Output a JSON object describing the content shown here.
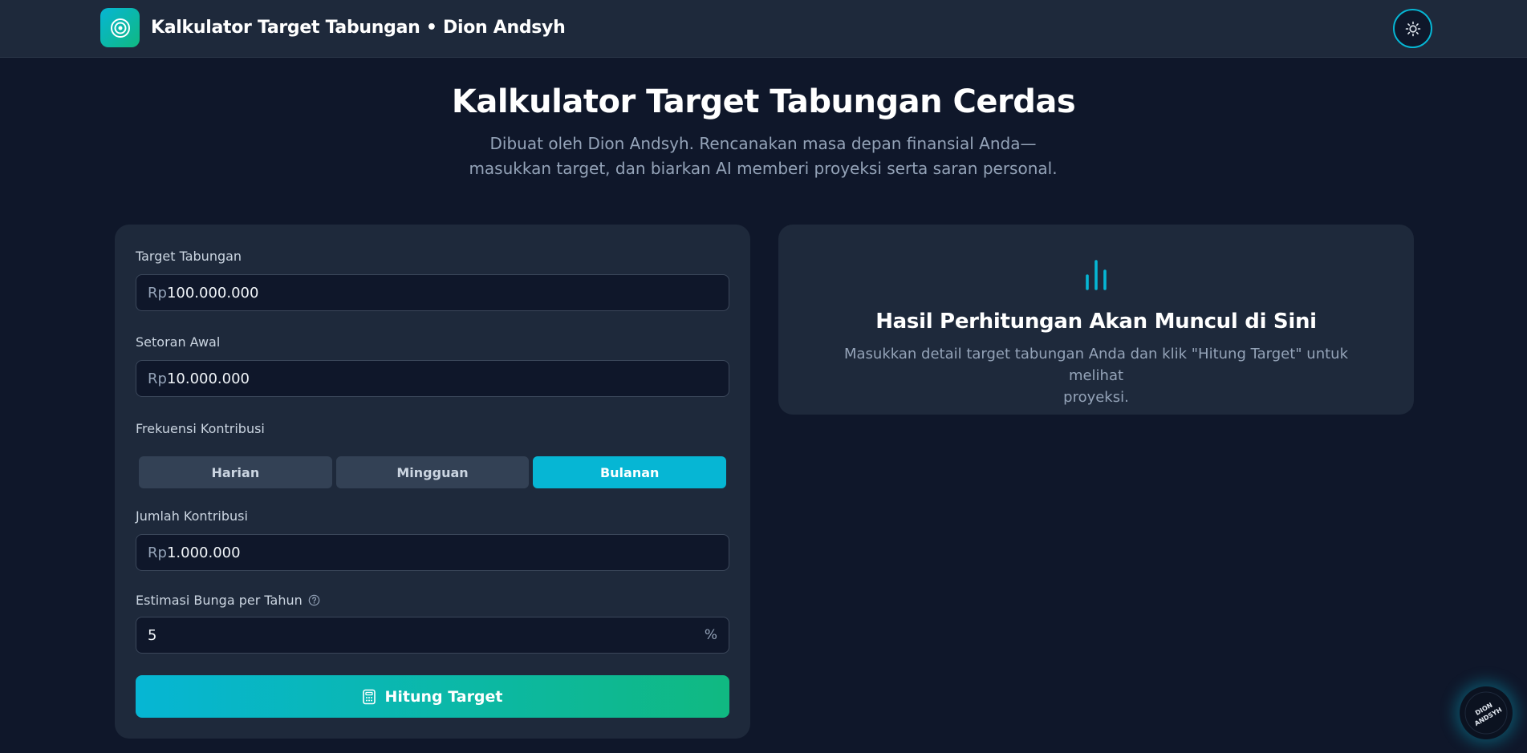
{
  "header": {
    "title": "Kalkulator Target Tabungan • Dion Andsyh",
    "logo_icon": "target-icon",
    "theme_toggle_icon": "sun-icon"
  },
  "hero": {
    "title": "Kalkulator Target Tabungan Cerdas",
    "subtitle_line1": "Dibuat oleh Dion Andsyh. Rencanakan masa depan finansial Anda—",
    "subtitle_line2": "masukkan target, dan biarkan AI memberi proyeksi serta saran personal."
  },
  "form": {
    "target": {
      "label": "Target Tabungan",
      "prefix": "Rp",
      "value": "100.000.000"
    },
    "initial": {
      "label": "Setoran Awal",
      "prefix": "Rp",
      "value": "10.000.000"
    },
    "frequency": {
      "label": "Frekuensi Kontribusi",
      "options": [
        "Harian",
        "Mingguan",
        "Bulanan"
      ],
      "selected": "Bulanan"
    },
    "contribution": {
      "label": "Jumlah Kontribusi",
      "prefix": "Rp",
      "value": "1.000.000"
    },
    "interest": {
      "label": "Estimasi Bunga per Tahun",
      "value": "5",
      "suffix": "%"
    },
    "submit_label": "Hitung Target"
  },
  "result": {
    "icon": "bar-chart-icon",
    "title": "Hasil Perhitungan Akan Muncul di Sini",
    "text_line1": "Masukkan detail target tabungan Anda dan klik \"Hitung Target\" untuk melihat",
    "text_line2": "proyeksi."
  },
  "badge": {
    "text": "DION ANDSYH"
  },
  "colors": {
    "background": "#0f172a",
    "card": "#1e293b",
    "accent": "#06b6d4",
    "accent2": "#10b981"
  }
}
